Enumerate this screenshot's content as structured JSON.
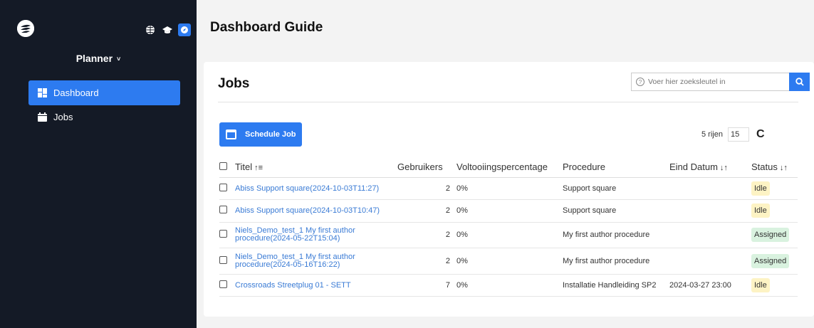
{
  "sidebar": {
    "app_switcher_label": "Planner",
    "items": [
      {
        "label": "Dashboard",
        "active": true
      },
      {
        "label": "Jobs",
        "active": false
      }
    ]
  },
  "header": {
    "title": "Dashboard Guide"
  },
  "jobs": {
    "title": "Jobs",
    "search_placeholder": "Voer hier zoeksleutel in",
    "schedule_label": "Schedule Job",
    "rows_label": "5 rijen",
    "rows_value": "15",
    "columns": [
      "Titel",
      "Gebruikers",
      "Voltooiingspercentage",
      "Procedure",
      "Eind Datum",
      "Status"
    ],
    "rows": [
      {
        "title": "Abiss Support square(2024-10-03T11:27)",
        "users": "2",
        "pct": "0%",
        "procedure": "Support square",
        "end_date": "",
        "status": "Idle"
      },
      {
        "title": "Abiss Support square(2024-10-03T10:47)",
        "users": "2",
        "pct": "0%",
        "procedure": "Support square",
        "end_date": "",
        "status": "Idle"
      },
      {
        "title": "Niels_Demo_test_1 My first author procedure(2024-05-22T15:04)",
        "users": "2",
        "pct": "0%",
        "procedure": "My first author procedure",
        "end_date": "",
        "status": "Assigned"
      },
      {
        "title": "Niels_Demo_test_1 My first author procedure(2024-05-16T16:22)",
        "users": "2",
        "pct": "0%",
        "procedure": "My first author procedure",
        "end_date": "",
        "status": "Assigned"
      },
      {
        "title": "Crossroads Streetplug 01 - SETT",
        "users": "7",
        "pct": "0%",
        "procedure": "Installatie Handleiding SP2",
        "end_date": "2024-03-27 23:00",
        "status": "Idle"
      }
    ]
  },
  "colors": {
    "accent": "#2d7bf0",
    "sidebar_bg": "#141a26",
    "idle_bg": "#fdf3c4",
    "assigned_bg": "#d9f2df",
    "link": "#3a7bd5"
  }
}
